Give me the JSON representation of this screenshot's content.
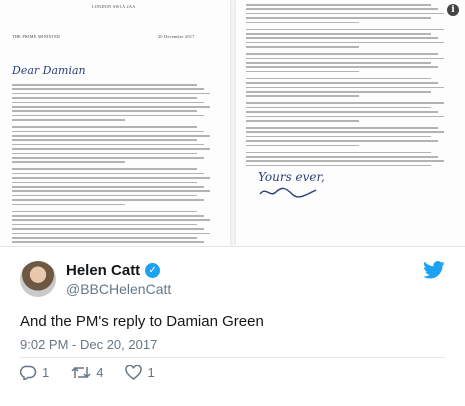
{
  "letter_left": {
    "address": "LONDON SW1A 2AA",
    "sender": "THE PRIME MINISTER",
    "date": "20 December 2017",
    "salutation": "Dear Damian"
  },
  "letter_right": {
    "signoff": "Yours ever,"
  },
  "tweet": {
    "author_name": "Helen Catt",
    "handle": "@BBCHelenCatt",
    "text": "And the PM's reply to Damian Green",
    "timestamp": "9:02 PM - Dec 20, 2017",
    "reply_count": "1",
    "retweet_count": "4",
    "like_count": "1"
  },
  "colors": {
    "twitter_blue": "#1da1f2",
    "text_primary": "#14171a",
    "text_secondary": "#657786"
  },
  "icons": [
    "info-icon",
    "verified-icon",
    "twitter-bird-icon",
    "reply-icon",
    "retweet-icon",
    "like-icon"
  ]
}
